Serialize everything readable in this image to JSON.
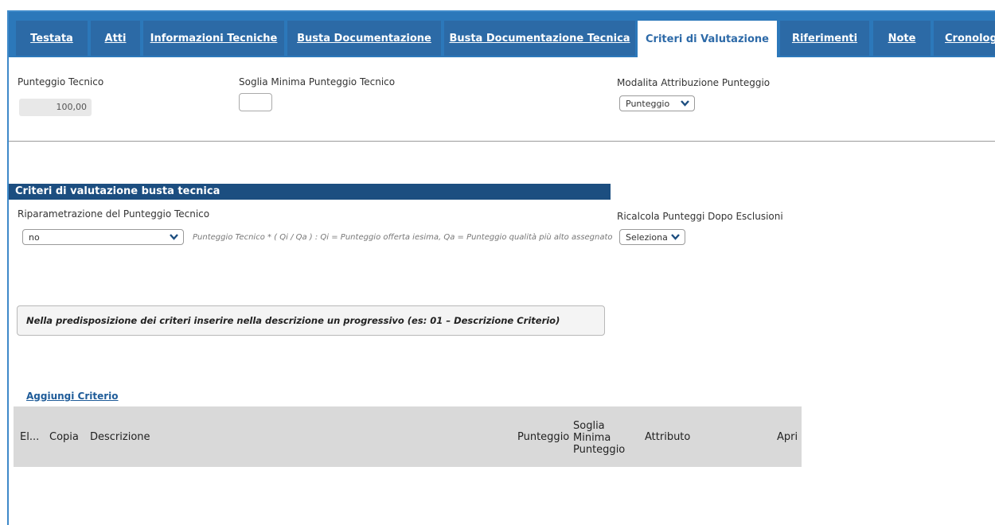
{
  "tabs": [
    {
      "label": "Testata",
      "active": false
    },
    {
      "label": "Atti",
      "active": false
    },
    {
      "label": "Informazioni Tecniche",
      "active": false
    },
    {
      "label": "Busta Documentazione",
      "active": false
    },
    {
      "label": "Busta Documentazione Tecnica",
      "active": false
    },
    {
      "label": "Criteri di Valutazione",
      "active": true
    },
    {
      "label": "Riferimenti",
      "active": false
    },
    {
      "label": "Note",
      "active": false
    },
    {
      "label": "Cronologia",
      "active": false
    }
  ],
  "fields": {
    "punteggio_tecnico_label": "Punteggio Tecnico",
    "punteggio_tecnico_value": "100,00",
    "soglia_minima_label": "Soglia Minima Punteggio Tecnico",
    "soglia_minima_value": "",
    "modalita_label": "Modalita Attribuzione Punteggio",
    "modalita_value": "Punteggio"
  },
  "section": {
    "title": "Criteri di valutazione busta tecnica",
    "riparametrazione_label": "Riparametrazione del Punteggio Tecnico",
    "riparametrazione_value": "no",
    "formula_hint": "Punteggio Tecnico * ( Qi / Qa ) : Qi = Punteggio offerta iesima, Qa = Punteggio qualità più alto assegnato",
    "ricalcola_label": "Ricalcola Punteggi Dopo Esclusioni",
    "ricalcola_value": "Seleziona"
  },
  "notice": "Nella predisposizione dei criteri inserire nella descrizione un progressivo (es: 01 – Descrizione Criterio)",
  "add_link": "Aggiungi Criterio",
  "table": {
    "columns": {
      "elimina": "El...",
      "copia": "Copia",
      "descrizione": "Descrizione",
      "punteggio": "Punteggio",
      "soglia_line1": "Soglia",
      "soglia_line2": "Minima",
      "soglia_line3": "Punteggio",
      "attributo": "Attributo",
      "apri": "Apri"
    }
  },
  "colors": {
    "tabbar": "#2c78ba",
    "tab": "#2c6aa6",
    "section_head": "#1c4e80",
    "link": "#1f5c99"
  }
}
